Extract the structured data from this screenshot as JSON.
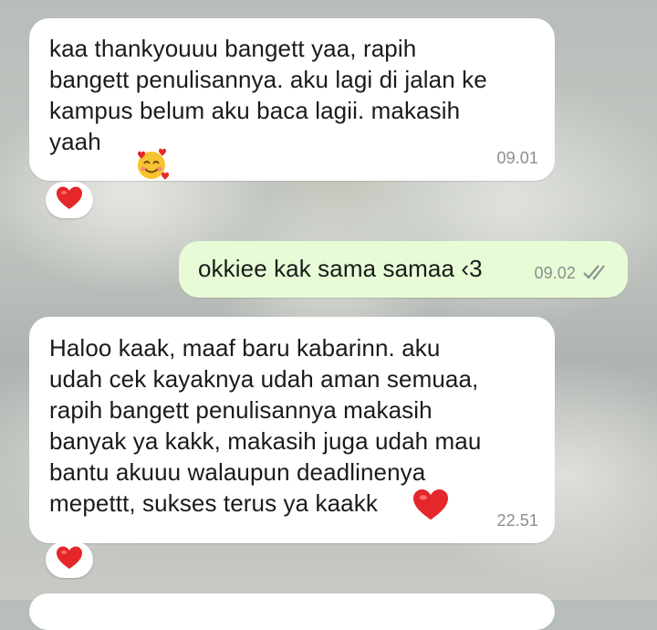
{
  "chat": {
    "messages": [
      {
        "direction": "incoming",
        "text": "kaa thankyouuu bangett yaa, rapih\nbangett penulisannya. aku lagi di jalan ke\nkampus belum aku baca lagii. makasih\nyaah",
        "emoji": "smiling-face-with-hearts",
        "time": "09.01",
        "reaction": "heart"
      },
      {
        "direction": "outgoing",
        "text": "okkiee kak sama samaa ‹3",
        "time": "09.02",
        "status": "delivered-double-check"
      },
      {
        "direction": "incoming",
        "text": "Haloo kaak, maaf baru kabarinn. aku\nudah cek kayaknya udah aman semuaa,\nrapih bangett penulisannya makasih\nbanyak ya kakk, makasih juga udah mau\nbantu akuuu walaupun deadlinenya\nmepettt, sukses terus ya kaakk",
        "emoji": "red-heart",
        "time": "22.51",
        "reaction": "heart"
      }
    ]
  },
  "colors": {
    "incoming_bubble": "#ffffff",
    "outgoing_bubble": "#e7fcd6",
    "timestamp": "#8a8f8d",
    "heart": "#e5262b"
  }
}
